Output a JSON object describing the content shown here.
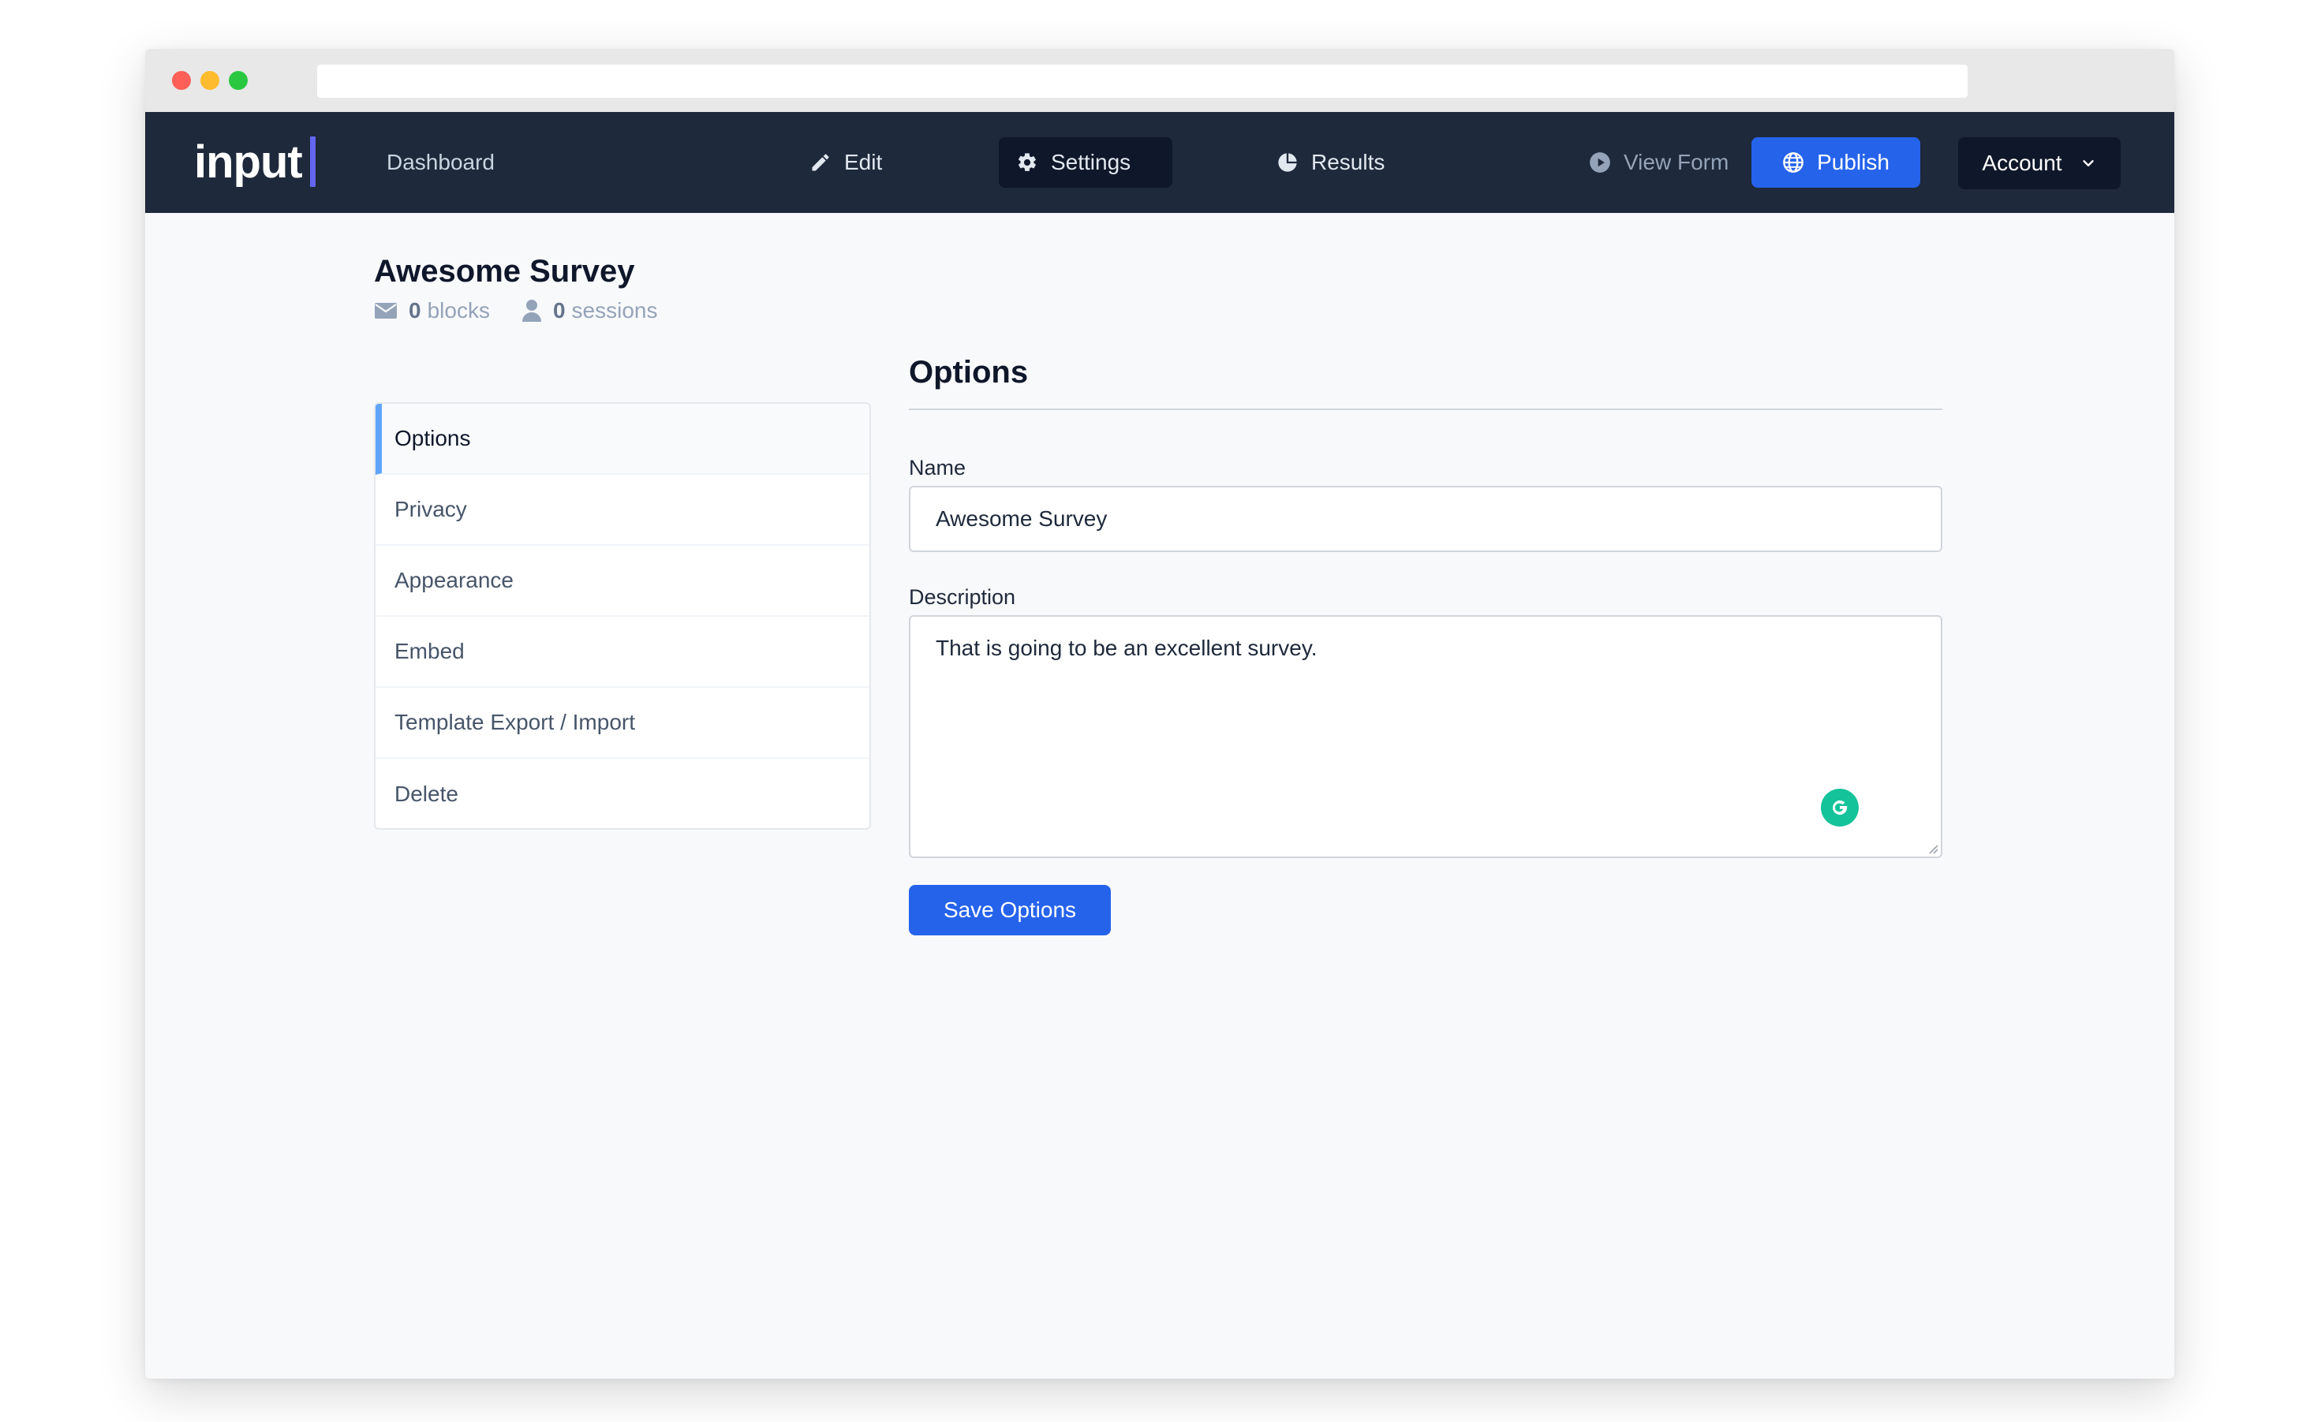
{
  "app": {
    "logo_text": "input"
  },
  "nav": {
    "dashboard": "Dashboard",
    "edit": "Edit",
    "settings": "Settings",
    "results": "Results",
    "view_form": "View Form",
    "publish": "Publish",
    "account": "Account"
  },
  "icons": {
    "edit": "pencil-icon",
    "settings": "gear-icon",
    "results": "pie-chart-icon",
    "view_form": "play-circle-icon",
    "publish": "globe-icon",
    "account": "chevron-down-icon",
    "blocks": "envelope-icon",
    "sessions": "user-icon"
  },
  "form": {
    "title": "Awesome Survey",
    "blocks_count": "0",
    "blocks_label": "blocks",
    "sessions_count": "0",
    "sessions_label": "sessions"
  },
  "sidebar": {
    "items": [
      {
        "label": "Options",
        "active": true
      },
      {
        "label": "Privacy",
        "active": false
      },
      {
        "label": "Appearance",
        "active": false
      },
      {
        "label": "Embed",
        "active": false
      },
      {
        "label": "Template Export / Import",
        "active": false
      },
      {
        "label": "Delete",
        "active": false
      }
    ]
  },
  "options": {
    "section_title": "Options",
    "name_label": "Name",
    "name_value": "Awesome Survey",
    "description_label": "Description",
    "description_value": "That is going to be an excellent survey.",
    "save_label": "Save Options"
  },
  "colors": {
    "navbar_bg": "#1e293b",
    "accent_blue": "#2563eb",
    "logo_bar": "#6366f1",
    "active_indicator": "#60a5fa"
  }
}
